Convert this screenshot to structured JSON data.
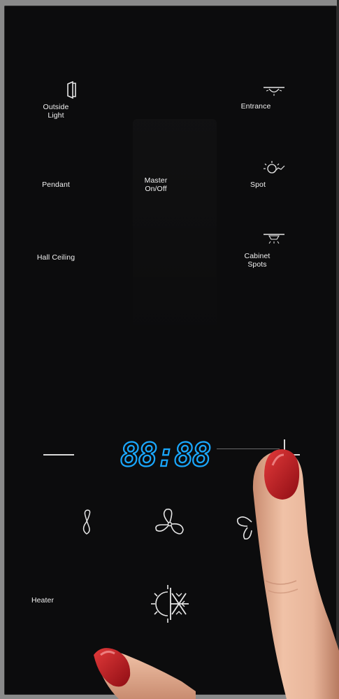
{
  "panel": {
    "buttons": {
      "outside_light": "Outside\nLight",
      "entrance": "Entrance",
      "pendant": "Pendant",
      "master": "Master\nOn/Off",
      "spot": "Spot",
      "hall_ceiling": "Hall Ceiling",
      "cabinet_spots": "Cabinet\nSpots",
      "heater": "Heater"
    },
    "display": {
      "value": "88:88",
      "color": "#1aa8ff"
    },
    "icons": {
      "outside_light": "door-icon",
      "entrance": "entrance-light-icon",
      "spot": "spot-light-icon",
      "cabinet_spots": "cabinet-spot-icon",
      "fan_low": "fan-low-icon",
      "fan_mid": "fan-medium-icon",
      "fan_high": "fan-high-icon",
      "climate": "heat-cool-icon",
      "minus": "minus-icon",
      "plus": "plus-icon"
    },
    "colors": {
      "background": "#0c0c0d",
      "text": "#f2f2f2",
      "nail": "#c1121f",
      "skin": "#e8b59a"
    }
  }
}
